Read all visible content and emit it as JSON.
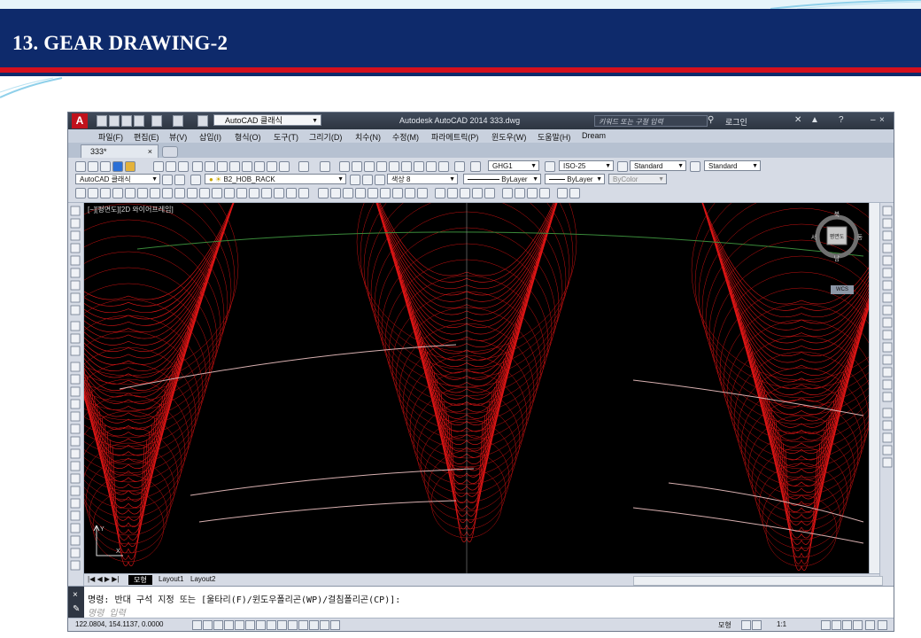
{
  "slide": {
    "title": "13.   GEAR DRAWING-2",
    "colors": {
      "navy": "#0e2a6b",
      "red": "#d4101d",
      "accent": "#8fd0ea"
    }
  },
  "app": {
    "logo": "A",
    "workspace": "AutoCAD 클래식",
    "title": "Autodesk AutoCAD 2014    333.dwg",
    "search_placeholder": "키워드 또는 구절 입력",
    "login": "로그인"
  },
  "menu": [
    "파일(F)",
    "편집(E)",
    "뷰(V)",
    "삽입(I)",
    "형식(O)",
    "도구(T)",
    "그리기(D)",
    "치수(N)",
    "수정(M)",
    "파라메트릭(P)",
    "윈도우(W)",
    "도움말(H)",
    "Dream"
  ],
  "doc_tab": "333*",
  "toolbar2": {
    "text_style": "GHG1",
    "dim_style": "ISO-25",
    "table_style": "Standard",
    "mleader_style": "Standard"
  },
  "toolbar3": {
    "workspace": "AutoCAD 클래식",
    "layer": "B2_HOB_RACK",
    "color": "색상 8",
    "linetype": "ByLayer",
    "lineweight": "ByLayer",
    "plotstyle": "ByColor"
  },
  "viewport": {
    "label": "[−][평면도][2D 와이어프레임]",
    "viewcube": {
      "north": "북",
      "south": "남",
      "west": "서",
      "east": "동",
      "face": "평면도"
    },
    "wcs": "WCS",
    "ucs_x": "X",
    "ucs_y": "Y"
  },
  "layout_tabs": [
    "모형",
    "Layout1",
    "Layout2"
  ],
  "command": {
    "history": "명령: 반대 구석 지정 또는 [울타리(F)/윈도우폴리곤(WP)/걸침폴리곤(CP)]:",
    "prompt": "명령 입력"
  },
  "status": {
    "coords": "122.0804, 154.1137, 0.0000",
    "model": "모형",
    "scale": "1:1"
  }
}
